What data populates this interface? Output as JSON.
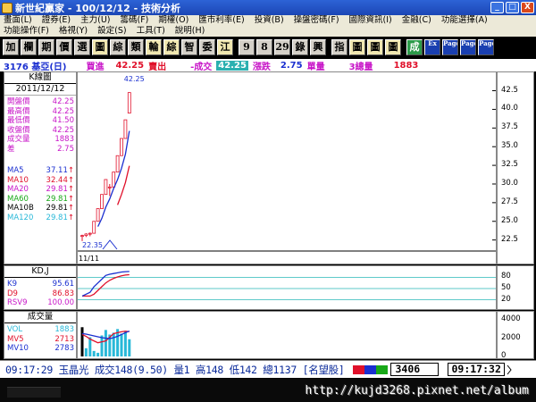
{
  "window": {
    "title": "新世紀贏家 - 100/12/12 - 技術分析",
    "buttons": {
      "minimize": "_",
      "maximize": "□",
      "close": "X"
    }
  },
  "menu": [
    "畫面(L)",
    "證券(E)",
    "主力(U)",
    "籌碼(F)",
    "期權(O)",
    "匯市利率(E)",
    "投資(B)",
    "操盤密碼(F)",
    "國際資訊(I)",
    "金融(C)",
    "功能選擇(A)",
    "功能操作(F)",
    "格視(Y)",
    "設定(S)",
    "工具(T)",
    "說明(H)"
  ],
  "toolbar": [
    {
      "label": "加",
      "style": "normal"
    },
    {
      "label": "欄",
      "style": "normal"
    },
    {
      "label": "期",
      "style": "normal"
    },
    {
      "label": "價",
      "style": "normal"
    },
    {
      "label": "選",
      "style": "normal"
    },
    {
      "label": "圖",
      "style": "colored"
    },
    {
      "label": "綜",
      "style": "normal"
    },
    {
      "label": "類",
      "style": "normal"
    },
    {
      "label": "輪",
      "style": "colored"
    },
    {
      "label": "綜",
      "style": "colored"
    },
    {
      "label": "智",
      "style": "normal"
    },
    {
      "label": "委",
      "style": "normal"
    },
    {
      "label": "江",
      "style": "colored"
    },
    {
      "label": "9",
      "style": "normal"
    },
    {
      "label": "8",
      "style": "normal"
    },
    {
      "label": "29",
      "style": "normal"
    },
    {
      "label": "錄",
      "style": "normal"
    },
    {
      "label": "興",
      "style": "normal"
    },
    {
      "label": "指",
      "style": "normal"
    },
    {
      "label": "圖",
      "style": "colored"
    },
    {
      "label": "圖",
      "style": "colored"
    },
    {
      "label": "圖",
      "style": "colored"
    },
    {
      "label": "成",
      "style": "green"
    },
    {
      "label": "Ex",
      "style": "blue"
    },
    {
      "label": "Page",
      "style": "blue"
    },
    {
      "label": "Page",
      "style": "blue"
    },
    {
      "label": "Page",
      "style": "blue"
    }
  ],
  "info": {
    "code_name": "3176 基亞(日)",
    "buy_label": "買進",
    "buy_value": "42.25",
    "sell_label": "賣出",
    "change_label": "-成交",
    "deal_value": "42.25",
    "change2_label": "漲跌",
    "change_value": "2.75",
    "unit_label": "單量",
    "total_label": "3總量",
    "total_value": "1883"
  },
  "kline_panel": {
    "title": "K線圖",
    "date": "2011/12/12",
    "rows": [
      {
        "label": "開盤價",
        "value": "42.25",
        "color": "#c816c8"
      },
      {
        "label": "最高價",
        "value": "42.25",
        "color": "#c816c8"
      },
      {
        "label": "最低價",
        "value": "41.50",
        "color": "#c816c8"
      },
      {
        "label": "收盤價",
        "value": "42.25",
        "color": "#c816c8"
      },
      {
        "label": "成交量",
        "value": "1883",
        "color": "#c816c8"
      },
      {
        "label": "差",
        "value": "2.75",
        "color": "#c816c8"
      }
    ],
    "ma_rows": [
      {
        "label": "MA5",
        "value": "37.11",
        "color": "#1a2fd0"
      },
      {
        "label": "MA10",
        "value": "32.44",
        "color": "#e0102a"
      },
      {
        "label": "MA20",
        "value": "29.81",
        "color": "#c816c8"
      },
      {
        "label": "MA60",
        "value": "29.81",
        "color": "#18a818"
      },
      {
        "label": "MA10B",
        "value": "29.81",
        "color": "#000000"
      },
      {
        "label": "MA120",
        "value": "29.81",
        "color": "#28b8d8"
      }
    ],
    "ma_arrow": "↑"
  },
  "kd_panel": {
    "title": "KD,J",
    "rows": [
      {
        "label": "K9",
        "value": "95.61",
        "color": "#1a2fd0"
      },
      {
        "label": "D9",
        "value": "86.83",
        "color": "#e0102a"
      },
      {
        "label": "RSV9",
        "value": "100.00",
        "color": "#c816c8"
      }
    ],
    "ticks": [
      "80",
      "50",
      "20"
    ]
  },
  "volume_panel": {
    "title": "成交量",
    "rows": [
      {
        "label": "VOL",
        "value": "1883",
        "color": "#28b8d8"
      },
      {
        "label": "MV5",
        "value": "2713",
        "color": "#e0102a"
      },
      {
        "label": "MV10",
        "value": "2783",
        "color": "#1a2fd0"
      }
    ],
    "ticks": [
      "4000",
      "2000",
      "0"
    ]
  },
  "price_axis": {
    "ticks": [
      "42.5",
      "40.0",
      "37.5",
      "35.0",
      "32.5",
      "30.0",
      "27.5",
      "25.0",
      "22.5"
    ],
    "high_label": "42.25",
    "low_label": "22.35",
    "date_label": "11/11"
  },
  "chart_data": {
    "type": "candlestick",
    "ylim": [
      21.5,
      44.0
    ],
    "candles": [
      [
        23.0,
        23.2,
        22.35,
        23.1
      ],
      [
        23.1,
        23.4,
        22.9,
        23.3
      ],
      [
        23.3,
        23.5,
        23.0,
        23.4
      ],
      [
        23.4,
        25.0,
        23.4,
        25.0
      ],
      [
        25.0,
        26.7,
        25.0,
        26.7
      ],
      [
        26.7,
        28.6,
        26.7,
        28.6
      ],
      [
        28.6,
        30.6,
        28.6,
        30.6
      ],
      [
        29.5,
        30.0,
        28.4,
        29.6
      ],
      [
        29.6,
        31.6,
        29.4,
        31.6
      ],
      [
        31.6,
        33.8,
        31.6,
        33.8
      ],
      [
        33.8,
        36.1,
        33.8,
        36.1
      ],
      [
        36.1,
        38.6,
        36.1,
        38.6
      ],
      [
        39.5,
        42.25,
        39.5,
        42.25
      ]
    ],
    "ma5": [
      null,
      null,
      null,
      null,
      24.3,
      25.4,
      26.9,
      28.0,
      29.4,
      30.6,
      32.1,
      34.0,
      37.11
    ],
    "ma10": [
      null,
      null,
      null,
      null,
      null,
      null,
      null,
      null,
      null,
      27.2,
      28.6,
      30.2,
      32.44
    ],
    "kd_k": [
      30,
      35,
      40,
      55,
      65,
      75,
      85,
      88,
      90,
      92,
      94,
      95,
      95.61
    ],
    "kd_d": [
      30,
      30,
      30,
      35,
      45,
      55,
      65,
      72,
      77,
      81,
      84,
      86,
      86.83
    ],
    "volume": [
      3200,
      900,
      2100,
      600,
      400,
      2300,
      2900,
      2400,
      2600,
      3000,
      2500,
      2800,
      1883
    ],
    "mv5": [
      2400,
      2200,
      1900,
      1700,
      1500,
      1600,
      1700,
      2100,
      2500,
      2600,
      2700,
      2760,
      2713
    ],
    "mv10": [
      2500,
      2450,
      2350,
      2250,
      2150,
      2050,
      2000,
      1950,
      2050,
      2200,
      2400,
      2600,
      2783
    ],
    "vol_max": 4500
  },
  "status": {
    "quote": "09:17:29 玉晶光 成交148(9.50) 量1 高148 低142 總1137 [名望股]",
    "code": "3406",
    "clock": "09:17:32"
  },
  "watermark": "http://kujd3268.pixnet.net/album"
}
